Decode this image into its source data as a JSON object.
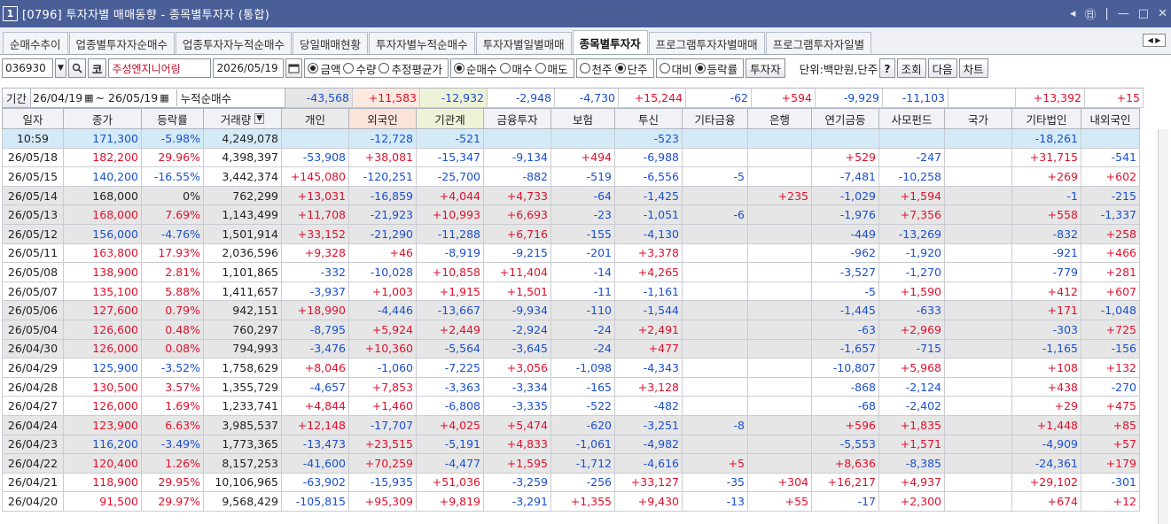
{
  "window": {
    "num": "1",
    "title": "[0796] 투자자별 매매동향 - 종목별투자자 (통합)",
    "controls": [
      "◂",
      "㊐",
      "|",
      "—",
      "□",
      "✕"
    ]
  },
  "tabs": [
    "순매수추이",
    "업종별투자자순매수",
    "업종투자자누적순매수",
    "당일매매현황",
    "투자자별누적순매수",
    "투자자별일별매매",
    "종목별투자자",
    "프로그램투자자별매매",
    "프로그램투자자일별"
  ],
  "active_tab": 6,
  "toolbar": {
    "code": "036930",
    "market_label": "코",
    "stock_name": "주성엔지니어링",
    "date": "2026/05/19",
    "radio1": [
      {
        "label": "금액",
        "on": true
      },
      {
        "label": "수량",
        "on": false
      },
      {
        "label": "추정평균가",
        "on": false
      }
    ],
    "radio2": [
      {
        "label": "순매수",
        "on": true
      },
      {
        "label": "매수",
        "on": false
      },
      {
        "label": "매도",
        "on": false
      }
    ],
    "radio3": [
      {
        "label": "천주",
        "on": false
      },
      {
        "label": "단주",
        "on": true
      }
    ],
    "radio4": [
      {
        "label": "대비",
        "on": false
      },
      {
        "label": "등락률",
        "on": true
      }
    ],
    "investor_btn": "투자자",
    "unit": "단위:백만원,단주",
    "help": "?",
    "query": "조회",
    "next": "다음",
    "chart": "차트"
  },
  "period": {
    "label": "기간",
    "from": "26/04/19",
    "to": "26/05/19",
    "cum_label": "누적순매수"
  },
  "summary": [
    "-43,568",
    "+11,583",
    "-12,932",
    "-2,948",
    "-4,730",
    "+15,244",
    "-62",
    "+594",
    "-9,929",
    "-11,103",
    "",
    "+13,392",
    "+15"
  ],
  "columns": [
    "일자",
    "종가",
    "등락률",
    "거래량",
    "개인",
    "외국인",
    "기관계",
    "금융투자",
    "보험",
    "투신",
    "기타금융",
    "은행",
    "연기금등",
    "사모펀드",
    "국가",
    "기타법인",
    "내외국인"
  ],
  "rows": [
    [
      "10:59",
      "171,300",
      "-5.98%",
      "4,249,078",
      "",
      "-12,728",
      "-521",
      "",
      "",
      "-523",
      "",
      "",
      "",
      "",
      "",
      "-18,261",
      ""
    ],
    [
      "26/05/18",
      "182,200",
      "29.96%",
      "4,398,397",
      "-53,908",
      "+38,081",
      "-15,347",
      "-9,134",
      "+494",
      "-6,988",
      "",
      "",
      "+529",
      "-247",
      "",
      "+31,715",
      "-541"
    ],
    [
      "26/05/15",
      "140,200",
      "-16.55%",
      "3,442,374",
      "+145,080",
      "-120,251",
      "-25,700",
      "-882",
      "-519",
      "-6,556",
      "-5",
      "",
      "-7,481",
      "-10,258",
      "",
      "+269",
      "+602"
    ],
    [
      "26/05/14",
      "168,000",
      "0%",
      "762,299",
      "+13,031",
      "-16,859",
      "+4,044",
      "+4,733",
      "-64",
      "-1,425",
      "",
      "+235",
      "-1,029",
      "+1,594",
      "",
      "-1",
      "-215"
    ],
    [
      "26/05/13",
      "168,000",
      "7.69%",
      "1,143,499",
      "+11,708",
      "-21,923",
      "+10,993",
      "+6,693",
      "-23",
      "-1,051",
      "-6",
      "",
      "-1,976",
      "+7,356",
      "",
      "+558",
      "-1,337"
    ],
    [
      "26/05/12",
      "156,000",
      "-4.76%",
      "1,501,914",
      "+33,152",
      "-21,290",
      "-11,288",
      "+6,716",
      "-155",
      "-4,130",
      "",
      "",
      "-449",
      "-13,269",
      "",
      "-832",
      "+258"
    ],
    [
      "26/05/11",
      "163,800",
      "17.93%",
      "2,036,596",
      "+9,328",
      "+46",
      "-8,919",
      "-9,215",
      "-201",
      "+3,378",
      "",
      "",
      "-962",
      "-1,920",
      "",
      "-921",
      "+466"
    ],
    [
      "26/05/08",
      "138,900",
      "2.81%",
      "1,101,865",
      "-332",
      "-10,028",
      "+10,858",
      "+11,404",
      "-14",
      "+4,265",
      "",
      "",
      "-3,527",
      "-1,270",
      "",
      "-779",
      "+281"
    ],
    [
      "26/05/07",
      "135,100",
      "5.88%",
      "1,411,657",
      "-3,937",
      "+1,003",
      "+1,915",
      "+1,501",
      "-11",
      "-1,161",
      "",
      "",
      "-5",
      "+1,590",
      "",
      "+412",
      "+607"
    ],
    [
      "26/05/06",
      "127,600",
      "0.79%",
      "942,151",
      "+18,990",
      "-4,446",
      "-13,667",
      "-9,934",
      "-110",
      "-1,544",
      "",
      "",
      "-1,445",
      "-633",
      "",
      "+171",
      "-1,048"
    ],
    [
      "26/05/04",
      "126,600",
      "0.48%",
      "760,297",
      "-8,795",
      "+5,924",
      "+2,449",
      "-2,924",
      "-24",
      "+2,491",
      "",
      "",
      "-63",
      "+2,969",
      "",
      "-303",
      "+725"
    ],
    [
      "26/04/30",
      "126,000",
      "0.08%",
      "794,993",
      "-3,476",
      "+10,360",
      "-5,564",
      "-3,645",
      "-24",
      "+477",
      "",
      "",
      "-1,657",
      "-715",
      "",
      "-1,165",
      "-156"
    ],
    [
      "26/04/29",
      "125,900",
      "-3.52%",
      "1,758,629",
      "+8,046",
      "-1,060",
      "-7,225",
      "+3,056",
      "-1,098",
      "-4,343",
      "",
      "",
      "-10,807",
      "+5,968",
      "",
      "+108",
      "+132"
    ],
    [
      "26/04/28",
      "130,500",
      "3.57%",
      "1,355,729",
      "-4,657",
      "+7,853",
      "-3,363",
      "-3,334",
      "-165",
      "+3,128",
      "",
      "",
      "-868",
      "-2,124",
      "",
      "+438",
      "-270"
    ],
    [
      "26/04/27",
      "126,000",
      "1.69%",
      "1,233,741",
      "+4,844",
      "+1,460",
      "-6,808",
      "-3,335",
      "-522",
      "-482",
      "",
      "",
      "-68",
      "-2,402",
      "",
      "+29",
      "+475"
    ],
    [
      "26/04/24",
      "123,900",
      "6.63%",
      "3,985,537",
      "+12,148",
      "-17,707",
      "+4,025",
      "+5,474",
      "-620",
      "-3,251",
      "-8",
      "",
      "+596",
      "+1,835",
      "",
      "+1,448",
      "+85"
    ],
    [
      "26/04/23",
      "116,200",
      "-3.49%",
      "1,773,365",
      "-13,473",
      "+23,515",
      "-5,191",
      "+4,833",
      "-1,061",
      "-4,982",
      "",
      "",
      "-5,553",
      "+1,571",
      "",
      "-4,909",
      "+57"
    ],
    [
      "26/04/22",
      "120,400",
      "1.26%",
      "8,157,253",
      "-41,600",
      "+70,259",
      "-4,477",
      "+1,595",
      "-1,712",
      "-4,616",
      "+5",
      "",
      "+8,636",
      "-8,385",
      "",
      "-24,361",
      "+179"
    ],
    [
      "26/04/21",
      "118,900",
      "29.95%",
      "10,106,965",
      "-63,902",
      "-15,935",
      "+51,036",
      "-3,259",
      "-256",
      "+33,127",
      "-35",
      "+304",
      "+16,217",
      "+4,937",
      "",
      "+29,102",
      "-301"
    ],
    [
      "26/04/20",
      "91,500",
      "29.97%",
      "9,568,429",
      "-105,815",
      "+95,309",
      "+9,819",
      "-3,291",
      "+1,355",
      "+9,430",
      "-13",
      "+55",
      "-17",
      "+2,300",
      "",
      "+674",
      "+12"
    ]
  ],
  "row_backgrounds": [
    "blue",
    "white",
    "white",
    "gray",
    "gray",
    "gray",
    "white",
    "white",
    "white",
    "gray",
    "gray",
    "gray",
    "white",
    "white",
    "white",
    "gray",
    "gray",
    "gray",
    "white",
    "white"
  ],
  "colors": {
    "title_bg": "#4a5f98",
    "positive": "#e0102c",
    "negative": "#1a4fd0",
    "gray_row": "#e6e6e6",
    "current_row": "#d4ebf7"
  }
}
